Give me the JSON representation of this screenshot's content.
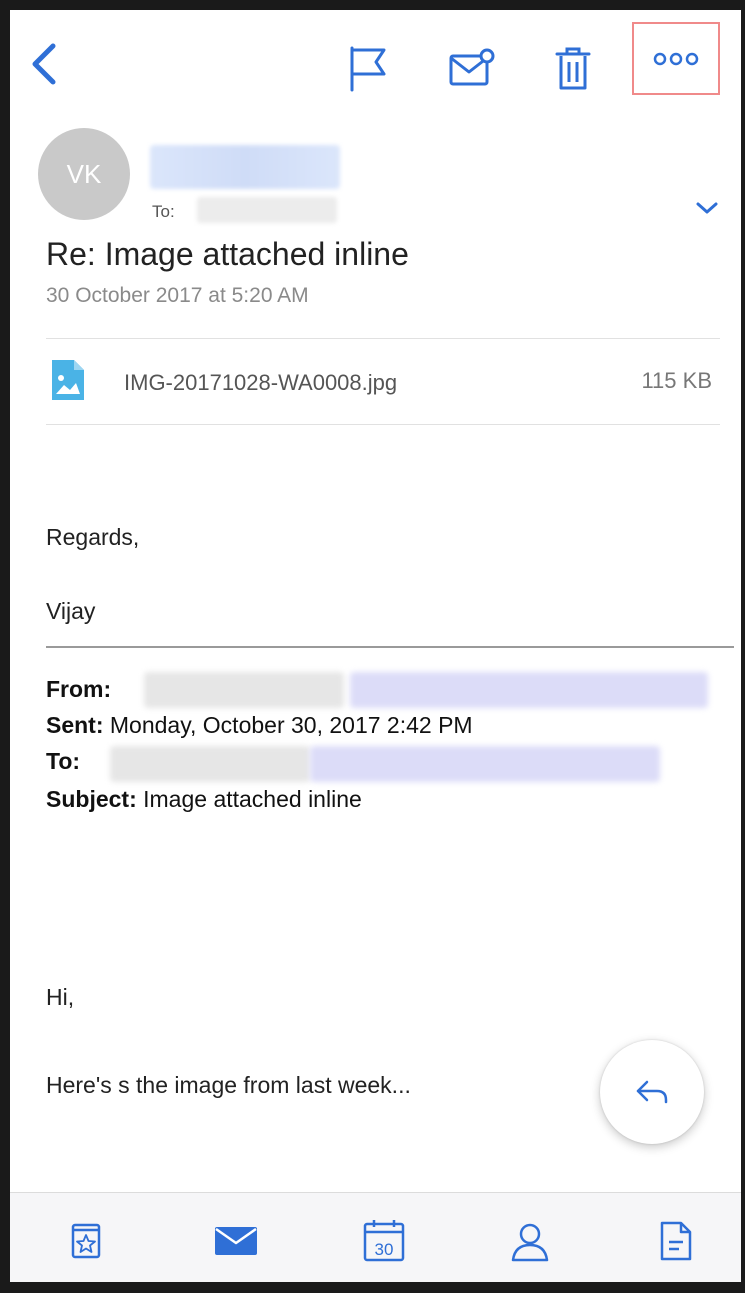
{
  "header": {
    "avatar_initials": "VK",
    "to_label": "To:",
    "subject": "Re: Image attached inline",
    "date": "30 October 2017 at 5:20 AM"
  },
  "toolbar": {
    "icons": [
      "back-icon",
      "flag-icon",
      "mark-unread-icon",
      "trash-icon",
      "more-icon"
    ]
  },
  "attachment": {
    "file_name": "IMG-20171028-WA0008.jpg",
    "file_size": "115 KB"
  },
  "body": {
    "regards": "Regards,",
    "signature": "Vijay",
    "quoted": {
      "from_label": "From:",
      "sent_label": "Sent:",
      "sent_value": " Monday, October 30, 2017 2:42 PM",
      "to_label": "To:",
      "subject_label": "Subject:",
      "subject_value": " Image attached inline"
    },
    "greeting": "Hi,",
    "message": "Here's s the image from last week..."
  },
  "tabbar": {
    "icons": [
      "favorites-icon",
      "mail-icon",
      "calendar-icon",
      "contacts-icon",
      "files-icon"
    ],
    "calendar_day": "30"
  },
  "colors": {
    "accent": "#2f6fd6",
    "highlight_border": "#f08a8a",
    "avatar_bg": "#c9c9c9",
    "attachment_icon": "#4ab3e6"
  }
}
